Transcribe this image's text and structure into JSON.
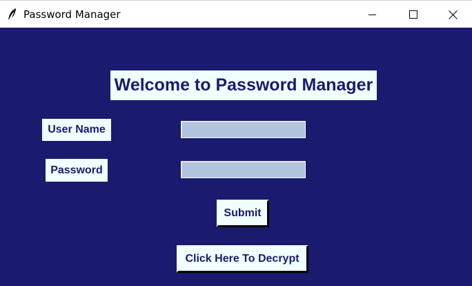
{
  "window": {
    "title": "Password Manager",
    "icon": "feather-icon",
    "controls": [
      "minimize-icon",
      "maximize-icon",
      "close-icon"
    ]
  },
  "colors": {
    "background": "#1a1a6e",
    "label_bg": "#f0ffff",
    "text": "#1a1a6e",
    "entry_bg": "#b0c4de"
  },
  "form": {
    "heading": "Welcome to Password Manager",
    "username_label": "User Name",
    "username_value": "",
    "password_label": "Password",
    "password_value": "",
    "submit_label": "Submit",
    "decrypt_label": "Click Here To Decrypt"
  }
}
